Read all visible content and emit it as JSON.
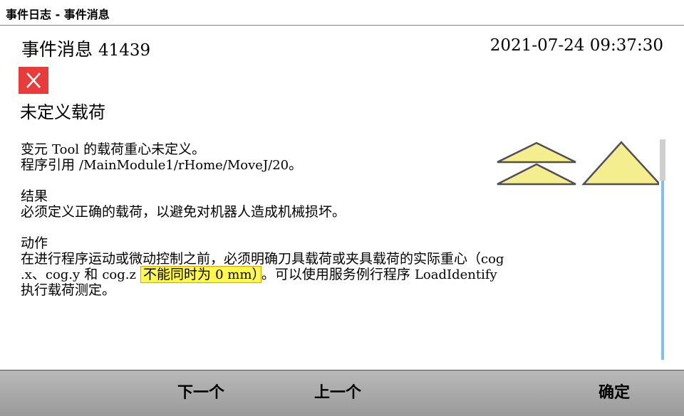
{
  "window": {
    "title": "事件日志 - 事件消息"
  },
  "event": {
    "label": "事件消息",
    "number": "41439",
    "timestamp": "2021-07-24 09:37:30",
    "icon": "error-x-icon",
    "title": "未定义载荷"
  },
  "description": {
    "line1_pre": "变元 ",
    "line1_code": "Tool",
    "line1_post": " 的载荷重心未定义。",
    "line2_pre": "程序引用 ",
    "line2_code": "/MainModule1/rHome/MoveJ/20",
    "line2_post": "。"
  },
  "result": {
    "heading": "结果",
    "text": "必须定义正确的载荷，以避免对机器人造成机械损坏。"
  },
  "action": {
    "heading": "动作",
    "l1_pre": "在进行程序运动或微动控制之前，必须明确刀具载荷或夹具载荷的实际重心（",
    "l1_code": "cog",
    "l2_code_a": ".x",
    "l2_sep": "、",
    "l2_code_b": "cog.y",
    "l2_and": " 和 ",
    "l2_code_c": "cog.z",
    "l2_hl_pre": "不能同时为 ",
    "l2_hl_code": "0 mm",
    "l2_hl_post": "）",
    "l2_post": "。可以使用服务例行程序 ",
    "l2_code_d": "LoadIdentify",
    "l3": "执行载荷测定。"
  },
  "buttons": {
    "next": "下一个",
    "previous": "上一个",
    "ok": "确定"
  },
  "colors": {
    "error": "#ea3b3b",
    "highlight": "#fff84d",
    "triangle_fill": "#f5ee8e",
    "scroll": "#7fc0ee"
  }
}
